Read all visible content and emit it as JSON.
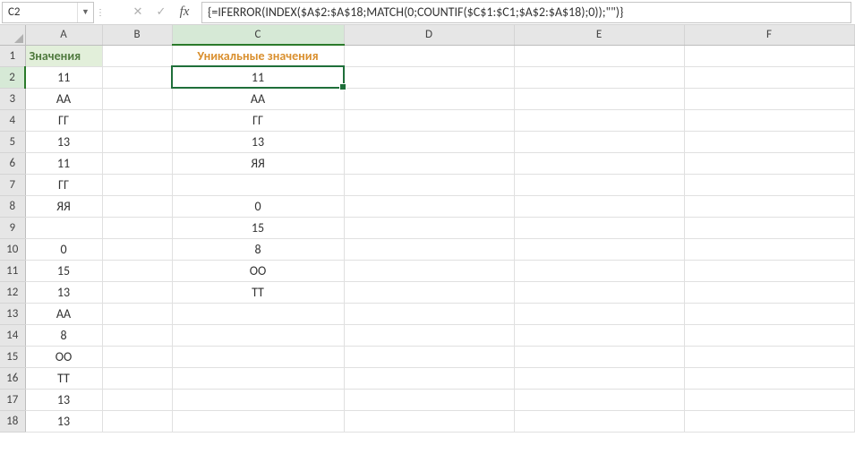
{
  "nameBox": {
    "value": "C2"
  },
  "formulaBar": {
    "cancel": "✕",
    "enter": "✓",
    "fx": "fx",
    "formula": "{=IFERROR(INDEX($A$2:$A$18;MATCH(0;COUNTIF($C$1:$C1;$A$2:$A$18);0));\"\")}"
  },
  "columns": [
    "A",
    "B",
    "C",
    "D",
    "E",
    "F"
  ],
  "rowCount": 18,
  "activeCell": {
    "row": 2,
    "col": "C"
  },
  "selectedCol": "C",
  "selectedRow": 2,
  "headers": {
    "A1": "Значения",
    "C1": "Уникальные значения"
  },
  "colA": [
    "11",
    "АА",
    "ГГ",
    "13",
    "11",
    "ГГ",
    "ЯЯ",
    "",
    "0",
    "15",
    "13",
    "АА",
    "8",
    "ОО",
    "ТТ",
    "13",
    "13"
  ],
  "colC": [
    "11",
    "АА",
    "ГГ",
    "13",
    "ЯЯ",
    "",
    "0",
    "15",
    "8",
    "ОО",
    "ТТ",
    "",
    "",
    "",
    "",
    "",
    ""
  ]
}
